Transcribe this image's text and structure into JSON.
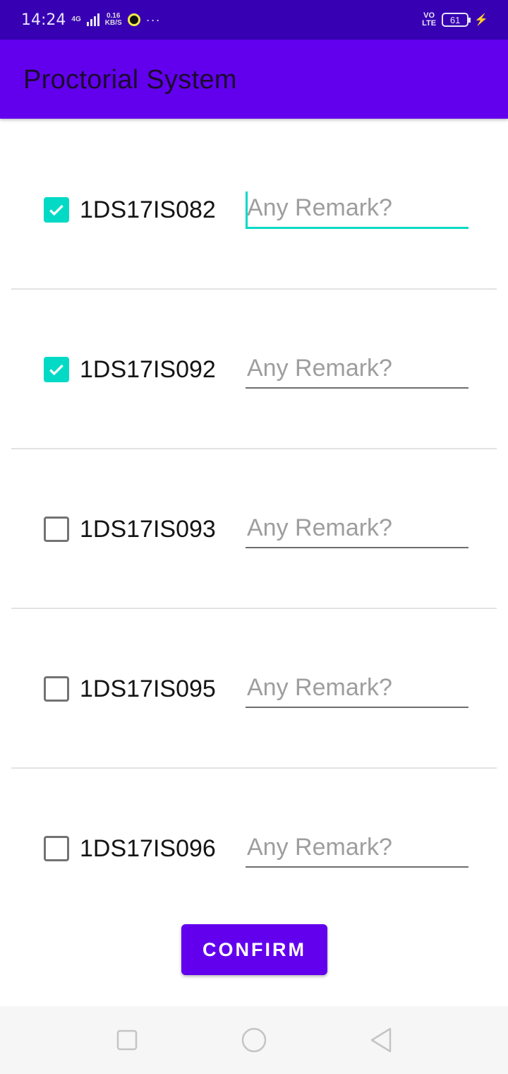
{
  "status_bar": {
    "time": "14:24",
    "network_type": "4G",
    "data_speed_value": "0.16",
    "data_speed_unit": "KB/S",
    "more": "···",
    "volte_top": "VO",
    "volte_bottom": "LTE",
    "battery": "61"
  },
  "app_bar": {
    "title": "Proctorial System",
    "color": "#6200ee"
  },
  "rows": [
    {
      "roll": "1DS17IS082",
      "checked": true,
      "remark_placeholder": "Any Remark?",
      "remark_value": "",
      "focused": true
    },
    {
      "roll": "1DS17IS092",
      "checked": true,
      "remark_placeholder": "Any Remark?",
      "remark_value": "",
      "focused": false
    },
    {
      "roll": "1DS17IS093",
      "checked": false,
      "remark_placeholder": "Any Remark?",
      "remark_value": "",
      "focused": false
    },
    {
      "roll": "1DS17IS095",
      "checked": false,
      "remark_placeholder": "Any Remark?",
      "remark_value": "",
      "focused": false
    },
    {
      "roll": "1DS17IS096",
      "checked": false,
      "remark_placeholder": "Any Remark?",
      "remark_value": "",
      "focused": false
    }
  ],
  "confirm_button": {
    "label": "CONFIRM"
  },
  "colors": {
    "accent": "#03dac5",
    "primary": "#6200ee",
    "status_bar": "#3700b3"
  },
  "nav_bar": {
    "icons": [
      "recents-icon",
      "home-icon",
      "back-icon"
    ]
  }
}
